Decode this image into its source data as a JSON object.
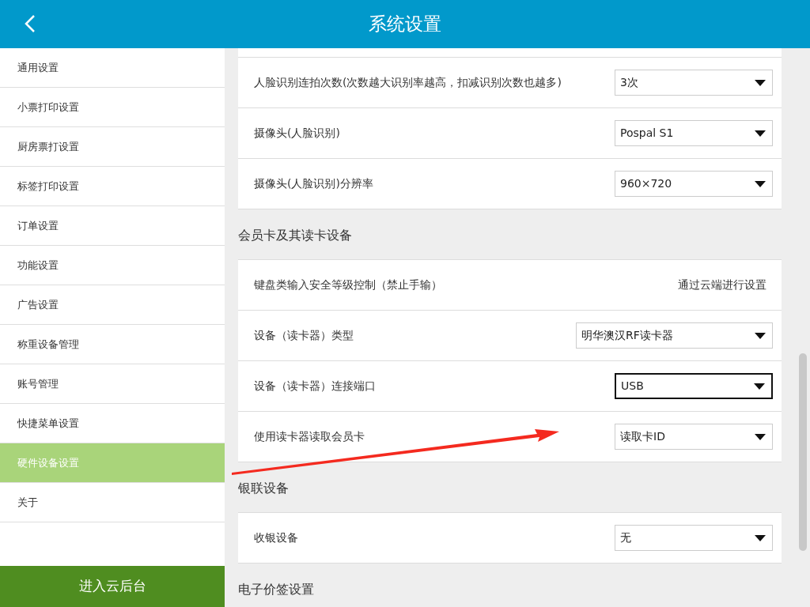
{
  "header": {
    "title": "系统设置"
  },
  "sidebar": {
    "items": [
      {
        "label": "通用设置",
        "selected": false
      },
      {
        "label": "小票打印设置",
        "selected": false
      },
      {
        "label": "厨房票打设置",
        "selected": false
      },
      {
        "label": "标签打印设置",
        "selected": false
      },
      {
        "label": "订单设置",
        "selected": false
      },
      {
        "label": "功能设置",
        "selected": false
      },
      {
        "label": "广告设置",
        "selected": false
      },
      {
        "label": "称重设备管理",
        "selected": false
      },
      {
        "label": "账号管理",
        "selected": false
      },
      {
        "label": "快捷菜单设置",
        "selected": false
      },
      {
        "label": "硬件设备设置",
        "selected": true
      },
      {
        "label": "关于",
        "selected": false
      }
    ],
    "footer_button": "进入云后台"
  },
  "sections": [
    {
      "rows": [
        {
          "kind": "select",
          "label": "人脸识别连拍次数(次数越大识别率越高，扣减识别次数也越多)",
          "value": "3次",
          "focused": false,
          "wide": false
        },
        {
          "kind": "select",
          "label": "摄像头(人脸识别)",
          "value": "Pospal S1",
          "focused": false,
          "wide": false
        },
        {
          "kind": "select",
          "label": "摄像头(人脸识别)分辨率",
          "value": "960×720",
          "focused": false,
          "wide": false
        }
      ]
    },
    {
      "title": "会员卡及其读卡设备",
      "rows": [
        {
          "kind": "text",
          "label": "键盘类输入安全等级控制（禁止手输）",
          "value": "通过云端进行设置"
        },
        {
          "kind": "select",
          "label": "设备（读卡器）类型",
          "value": "明华澳汉RF读卡器",
          "focused": false,
          "wide": true
        },
        {
          "kind": "select",
          "label": "设备（读卡器）连接端口",
          "value": "USB",
          "focused": true,
          "wide": false
        },
        {
          "kind": "select",
          "label": "使用读卡器读取会员卡",
          "value": "读取卡ID",
          "focused": false,
          "wide": false
        }
      ]
    },
    {
      "title": "银联设备",
      "rows": [
        {
          "kind": "select",
          "label": "收银设备",
          "value": "无",
          "focused": false,
          "wide": false
        }
      ]
    },
    {
      "title": "电子价签设置"
    }
  ]
}
